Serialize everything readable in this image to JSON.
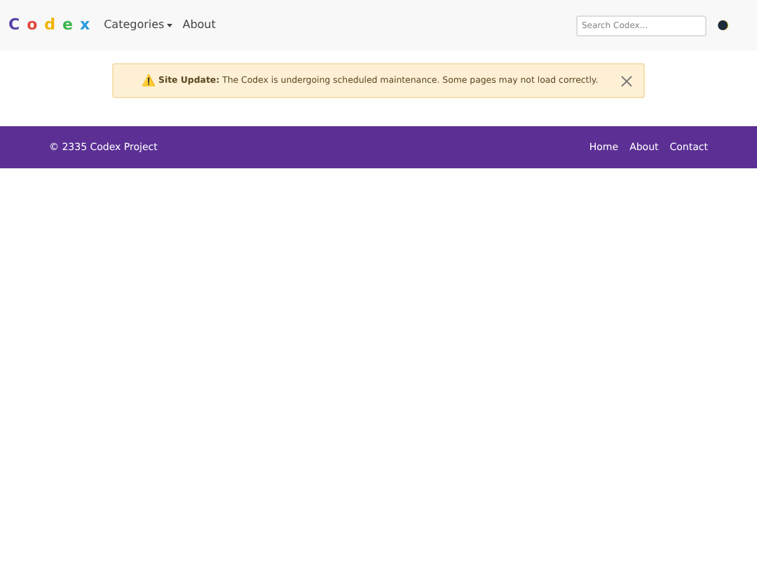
{
  "navbar": {
    "logo_letters": [
      {
        "text": "C",
        "color": "#5b3ea6"
      },
      {
        "text": "o",
        "color": "#e0483e"
      },
      {
        "text": "d",
        "color": "#f0b400"
      },
      {
        "text": "e",
        "color": "#3bb54a"
      },
      {
        "text": "x",
        "color": "#2a9be0"
      }
    ],
    "links": [
      {
        "label": "Categories",
        "dropdown": true
      },
      {
        "label": "About",
        "dropdown": false
      }
    ],
    "search": {
      "placeholder": "Search Codex..."
    }
  },
  "alert": {
    "icon": "⚠️",
    "text": "**Site Update:** The Codex is undergoing scheduled maintenance. Some pages may not load correctly."
  },
  "footer": {
    "copyright": "© 2335 Codex Project",
    "links": [
      "Home",
      "About",
      "Contact"
    ]
  }
}
